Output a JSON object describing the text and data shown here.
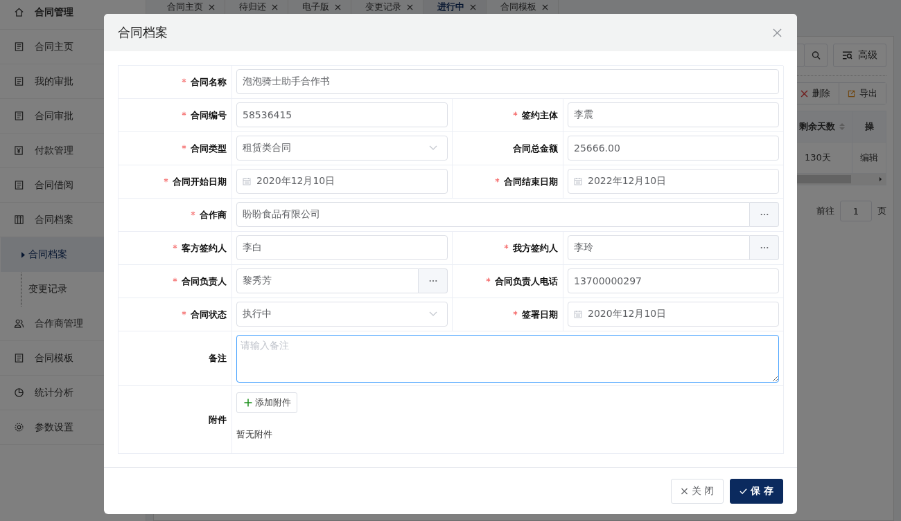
{
  "sidebar": {
    "items": [
      {
        "label": "合同管理",
        "kind": "header"
      },
      {
        "label": "合同主页",
        "kind": "item"
      },
      {
        "label": "我的审批",
        "kind": "item"
      },
      {
        "label": "合同审批",
        "kind": "item"
      },
      {
        "label": "付款管理",
        "kind": "item"
      },
      {
        "label": "合同借阅",
        "kind": "item"
      },
      {
        "label": "合同档案",
        "kind": "group",
        "children": [
          {
            "label": "合同档案",
            "selected": true
          },
          {
            "label": "变更记录",
            "selected": false
          }
        ]
      },
      {
        "label": "合作商管理",
        "kind": "item"
      },
      {
        "label": "合同模板",
        "kind": "item"
      },
      {
        "label": "统计分析",
        "kind": "item"
      },
      {
        "label": "参数设置",
        "kind": "item"
      }
    ]
  },
  "tabs": [
    {
      "label": "合同主页",
      "selected": false
    },
    {
      "label": "待归还",
      "selected": false
    },
    {
      "label": "电子版",
      "selected": false
    },
    {
      "label": "变更记录",
      "selected": false
    },
    {
      "label": "进行中",
      "selected": true
    },
    {
      "label": "合同模板",
      "selected": false
    }
  ],
  "toolbar": {
    "advanced_button": "高级",
    "delete_button": "删除",
    "export_button": "导出"
  },
  "table": {
    "columns": [
      "剩余天数",
      "操"
    ],
    "rows": [
      [
        "130天",
        "编辑"
      ]
    ]
  },
  "pagination": {
    "goto_label": "前往",
    "page": "1",
    "page_suffix": "页"
  },
  "dialog": {
    "title": "合同档案",
    "rows": [
      [
        {
          "label": "合同名称",
          "required": true,
          "kind": "text",
          "value": "泡泡骑士助手合作书"
        }
      ],
      [
        {
          "label": "合同编号",
          "required": true,
          "kind": "text",
          "value": "58536415"
        },
        {
          "label": "签约主体",
          "required": true,
          "kind": "text",
          "value": "李震"
        }
      ],
      [
        {
          "label": "合同类型",
          "required": true,
          "kind": "select",
          "value": "租赁类合同"
        },
        {
          "label": "合同总金额",
          "required": false,
          "kind": "text",
          "value": "25666.00"
        }
      ],
      [
        {
          "label": "合同开始日期",
          "required": true,
          "kind": "date",
          "value": "2020年12月10日"
        },
        {
          "label": "合同结束日期",
          "required": true,
          "kind": "date",
          "value": "2022年12月10日"
        }
      ],
      [
        {
          "label": "合作商",
          "required": true,
          "kind": "lookup",
          "value": "盼盼食品有限公司"
        }
      ],
      [
        {
          "label": "客方签约人",
          "required": true,
          "kind": "text",
          "value": "李白"
        },
        {
          "label": "我方签约人",
          "required": true,
          "kind": "lookup",
          "value": "李玲"
        }
      ],
      [
        {
          "label": "合同负责人",
          "required": true,
          "kind": "lookup",
          "value": "黎秀芳"
        },
        {
          "label": "合同负责人电话",
          "required": true,
          "kind": "text",
          "value": "13700000297"
        }
      ],
      [
        {
          "label": "合同状态",
          "required": true,
          "kind": "select",
          "value": "执行中"
        },
        {
          "label": "签署日期",
          "required": true,
          "kind": "date",
          "value": "2020年12月10日"
        }
      ],
      [
        {
          "label": "备注",
          "required": false,
          "kind": "textarea",
          "placeholder": "请输入备注"
        }
      ]
    ],
    "attachment": {
      "label": "附件",
      "button": "添加附件",
      "empty_text": "暂无附件"
    },
    "buttons": {
      "close": "关 闭",
      "save": "保 存"
    }
  }
}
